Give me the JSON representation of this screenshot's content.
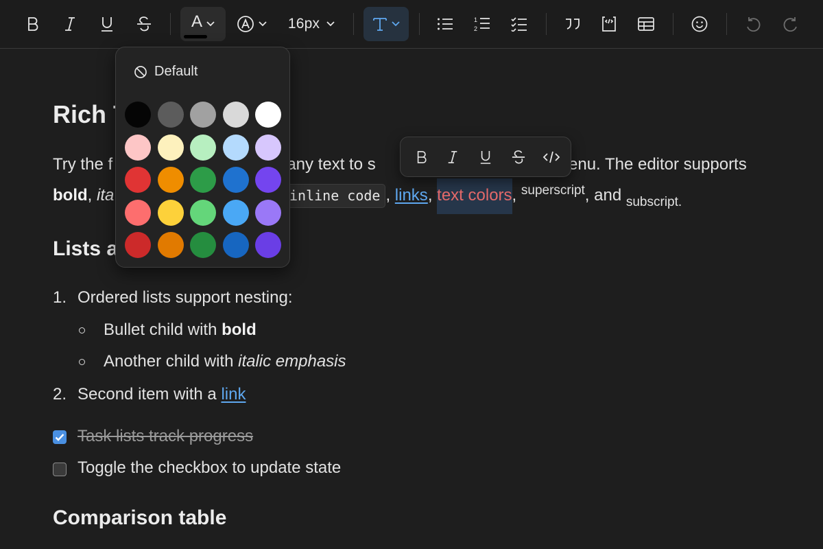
{
  "toolbar": {
    "font_size_label": "16px",
    "text_color_letter": "A",
    "buttons": [
      "bold",
      "italic",
      "underline",
      "strikethrough",
      "text-color",
      "highlight",
      "font-size",
      "text-style",
      "bullet-list",
      "ordered-list",
      "task-list",
      "blockquote",
      "code-block",
      "table",
      "emoji",
      "undo",
      "redo"
    ]
  },
  "color_popover": {
    "default_label": "Default",
    "swatches": [
      [
        "#050505",
        "#5c5c5c",
        "#a1a1a1",
        "#d9d9d9",
        "#ffffff"
      ],
      [
        "#fdc6c6",
        "#fdf1bd",
        "#b7efc0",
        "#b4dafd",
        "#d7c7fd"
      ],
      [
        "#e03434",
        "#ef8d00",
        "#2d9c48",
        "#1f72cf",
        "#7445ef"
      ],
      [
        "#fd6e6e",
        "#fdd13a",
        "#64d67a",
        "#4aa8f5",
        "#9a78f7"
      ],
      [
        "#cc2a2a",
        "#e17a00",
        "#258d3f",
        "#1766c0",
        "#6a3ee5"
      ]
    ]
  },
  "bubble_menu": {
    "bold": "B",
    "italic": "I",
    "underline": "U",
    "strike": "S",
    "code": "</>"
  },
  "document": {
    "title_visible": "Rich T",
    "para1_line1_a": "Try the f",
    "para1_line1_b": "t any text to s",
    "para1_line1_c": "enu. The editor supports",
    "para1_bold": "bold",
    "para1_comma1": ",",
    "para1_italic_partial": "ita",
    "para1_code": "inline code",
    "para1_comma2": ",",
    "para1_link": "links",
    "para1_comma3": ",",
    "para1_colored": "text colors",
    "para1_comma4": ",",
    "para1_sup": "superscript",
    "para1_and": ", and",
    "para1_sub": "subscript",
    "para1_end": ".",
    "h2_lists": "Lists a",
    "ol_1_num": "1.",
    "ol_1_text": "Ordered lists support nesting:",
    "ul_1_text": "Bullet child with",
    "ul_1_bold": "bold",
    "ul_2_text": "Another child with",
    "ul_2_italic": "italic emphasis",
    "ol_2_num": "2.",
    "ol_2_text": "Second item with a",
    "ol_2_link": "link",
    "task_1": "Task lists track progress",
    "task_2": "Toggle the checkbox to update state",
    "h2_table": "Comparison table"
  },
  "colors": {
    "accent": "#4a90e2",
    "link": "#5fa8f0",
    "red_text": "#e56a6a",
    "background": "#1e1e1e"
  }
}
